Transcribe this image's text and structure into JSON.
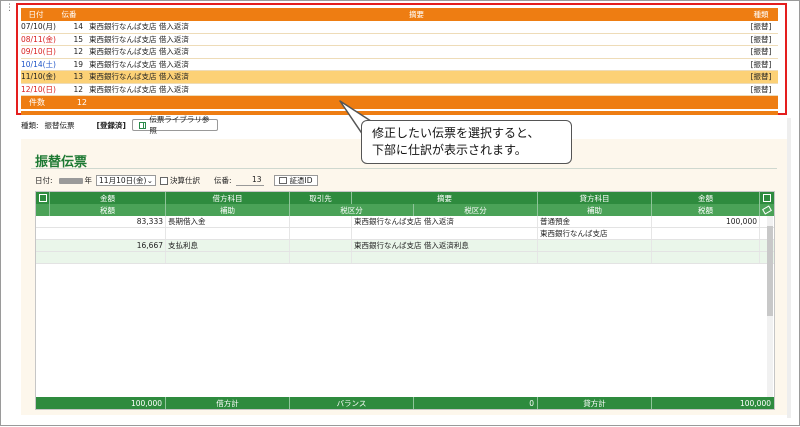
{
  "list": {
    "headers": {
      "date": "日付",
      "no": "伝番",
      "memo": "摘要",
      "kind": "種類"
    },
    "rows": [
      {
        "date": "07/10(月)",
        "no": "14",
        "memo": "東西銀行なんば支店 借入返済",
        "kind": "[振替]",
        "day": "wkd"
      },
      {
        "date": "08/11(金)",
        "no": "15",
        "memo": "東西銀行なんば支店 借入返済",
        "kind": "[振替]",
        "day": "sun"
      },
      {
        "date": "09/10(日)",
        "no": "12",
        "memo": "東西銀行なんば支店 借入返済",
        "kind": "[振替]",
        "day": "sun"
      },
      {
        "date": "10/14(土)",
        "no": "19",
        "memo": "東西銀行なんば支店 借入返済",
        "kind": "[振替]",
        "day": "sat"
      },
      {
        "date": "11/10(金)",
        "no": "13",
        "memo": "東西銀行なんば支店 借入返済",
        "kind": "[振替]",
        "day": "wkd",
        "selected": true
      },
      {
        "date": "12/10(日)",
        "no": "12",
        "memo": "東西銀行なんば支店 借入返済",
        "kind": "[振替]",
        "day": "sun"
      }
    ],
    "footer": {
      "label": "件数",
      "count": "12"
    }
  },
  "info": {
    "kind_label": "種類:",
    "kind_value": "振替伝票",
    "registered": "[登録済]",
    "library_button": "伝票ライブラリ参照"
  },
  "callout": {
    "line1": "修正したい伝票を選択すると、",
    "line2": "下部に仕訳が表示されます。"
  },
  "panel": {
    "title": "振替伝票",
    "date_label": "日付:",
    "year_suffix": "年",
    "date_value": "11月10日(金)",
    "closing_label": "決算仕訳",
    "no_label": "伝番:",
    "no_value": "13",
    "cert_button": "証憑ID"
  },
  "grid": {
    "head": [
      "金額",
      "借方科目",
      "取引先",
      "摘要",
      "貸方科目",
      "金額"
    ],
    "sub": [
      "税額",
      "補助",
      "税区分",
      "税区分",
      "補助",
      "税額"
    ],
    "rows": [
      {
        "debit_amount": "83,333",
        "debit_account": "長期借入金",
        "partner": "",
        "memo": "東西銀行なんば支店 借入返済",
        "credit_account": "普通預金",
        "credit_amount": "100,000",
        "alt": false
      },
      {
        "debit_amount": "",
        "debit_account": "",
        "partner": "",
        "memo": "",
        "credit_account": "東西銀行なんば支店",
        "credit_amount": "",
        "alt": false
      },
      {
        "debit_amount": "16,667",
        "debit_account": "支払利息",
        "partner": "",
        "memo": "東西銀行なんば支店 借入返済利息",
        "credit_account": "",
        "credit_amount": "",
        "alt": true
      },
      {
        "debit_amount": "",
        "debit_account": "",
        "partner": "",
        "memo": "",
        "credit_account": "",
        "credit_amount": "",
        "alt": true
      }
    ],
    "footer": {
      "debit_total": "100,000",
      "debit_label": "借方計",
      "balance_label": "バランス",
      "balance_value": "0",
      "credit_label": "貸方計",
      "credit_total": "100,000"
    }
  }
}
